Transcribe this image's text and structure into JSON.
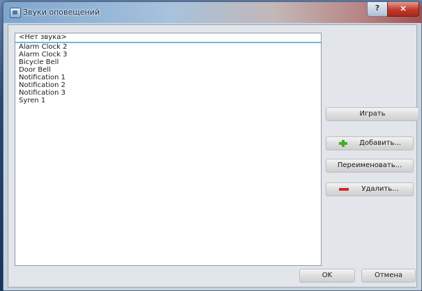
{
  "window": {
    "title": "Звуки оповещений",
    "help_label": "?",
    "close_label": "×"
  },
  "sounds": [
    "<Нет звука>",
    "Alarm Clock 2",
    "Alarm Clock 3",
    "Bicycle Bell",
    "Door Bell",
    "Notification 1",
    "Notification 2",
    "Notification 3",
    "Syren 1"
  ],
  "selected_index": 0,
  "buttons": {
    "play": "Играть",
    "add": "Добавить...",
    "rename": "Переименовать...",
    "delete": "Удалить...",
    "ok": "OK",
    "cancel": "Отмена"
  }
}
